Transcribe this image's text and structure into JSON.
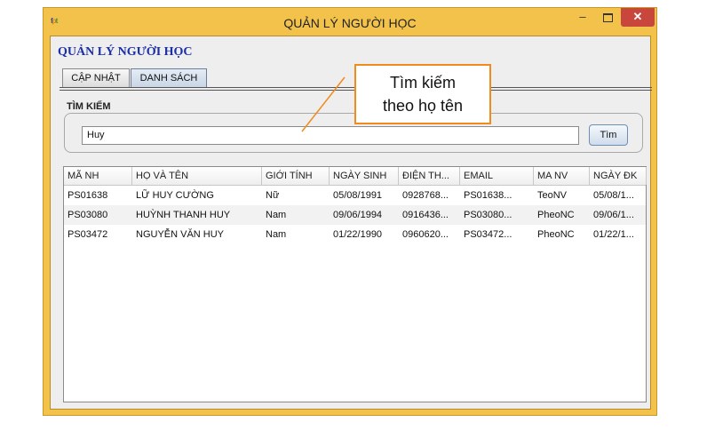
{
  "window": {
    "title": "QUẢN LÝ NGƯỜI HỌC",
    "minimize": "–",
    "close": "✕"
  },
  "app": {
    "heading": "QUẢN LÝ NGƯỜI HỌC"
  },
  "tabs": [
    {
      "label": "CẬP NHẬT",
      "active": false
    },
    {
      "label": "DANH SÁCH",
      "active": true
    }
  ],
  "search": {
    "label": "TÌM KIẾM",
    "value": "Huy",
    "button": "Tìm"
  },
  "table": {
    "columns": [
      "MÃ NH",
      "HỌ VÀ TÊN",
      "GIỚI TÍNH",
      "NGÀY SINH",
      "ĐIỆN TH...",
      "EMAIL",
      "MA NV",
      "NGÀY ĐK"
    ],
    "rows": [
      [
        "PS01638",
        "LỮ HUY CƯỜNG",
        "Nữ",
        "05/08/1991",
        "0928768...",
        "PS01638...",
        "TeoNV",
        "05/08/1..."
      ],
      [
        "PS03080",
        "HUỲNH THANH HUY",
        "Nam",
        "09/06/1994",
        "0916436...",
        "PS03080...",
        "PheoNC",
        "09/06/1..."
      ],
      [
        "PS03472",
        "NGUYỄN VĂN HUY",
        "Nam",
        "01/22/1990",
        "0960620...",
        "PS03472...",
        "PheoNC",
        "01/22/1..."
      ]
    ]
  },
  "annotation": {
    "line1": "Tìm kiếm",
    "line2": "theo họ tên"
  },
  "colors": {
    "frame": "#f2c24a",
    "heading": "#1b2fa8",
    "callout_border": "#f28a1c",
    "close_button": "#c9463d"
  }
}
